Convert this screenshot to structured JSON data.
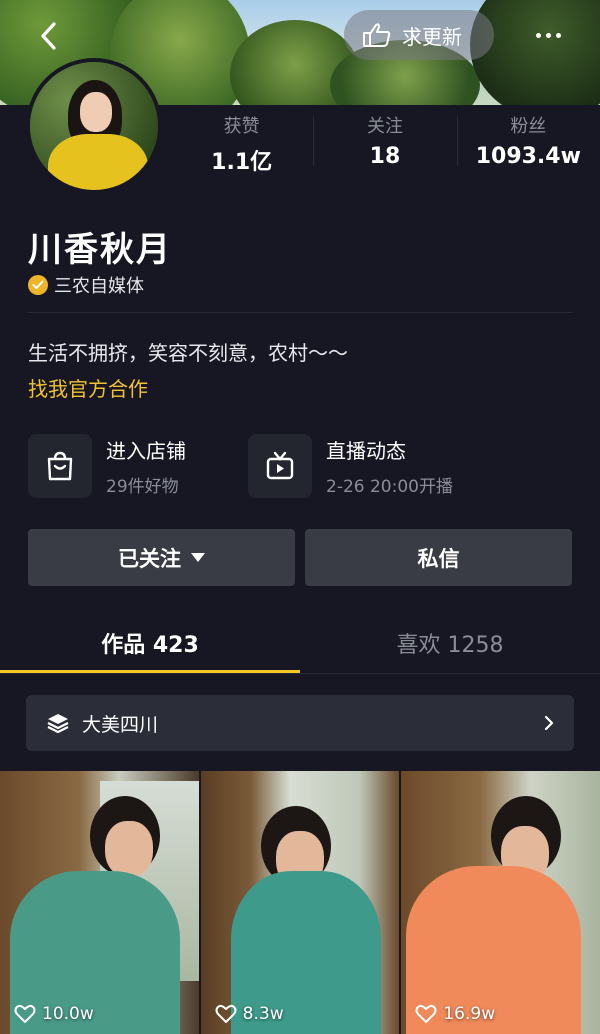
{
  "header": {
    "update_label": "求更新"
  },
  "stats": [
    {
      "label": "获赞",
      "value": "1.1亿"
    },
    {
      "label": "关注",
      "value": "18"
    },
    {
      "label": "粉丝",
      "value": "1093.4w"
    }
  ],
  "profile": {
    "name": "川香秋月",
    "certification": "三农自媒体",
    "bio": "生活不拥挤，笑容不刻意，农村～～",
    "cooperation_link": "找我官方合作"
  },
  "cards": {
    "shop": {
      "title": "进入店铺",
      "subtitle": "29件好物"
    },
    "live": {
      "title": "直播动态",
      "subtitle": "2-26 20:00开播"
    }
  },
  "actions": {
    "follow_label": "已关注",
    "message_label": "私信"
  },
  "tabs": [
    {
      "label": "作品 423",
      "active": true
    },
    {
      "label": "喜欢 1258",
      "active": false
    }
  ],
  "collection": {
    "label": "大美四川"
  },
  "videos": [
    {
      "likes": "10.0w",
      "outfit_color": "#4a9a88"
    },
    {
      "likes": "8.3w",
      "outfit_color": "#3e9a8a"
    },
    {
      "likes": "16.9w",
      "outfit_color": "#f08a5a"
    }
  ],
  "colors": {
    "background": "#161722",
    "accent": "#f6c522",
    "link": "#f2c230",
    "button": "#393b45"
  }
}
